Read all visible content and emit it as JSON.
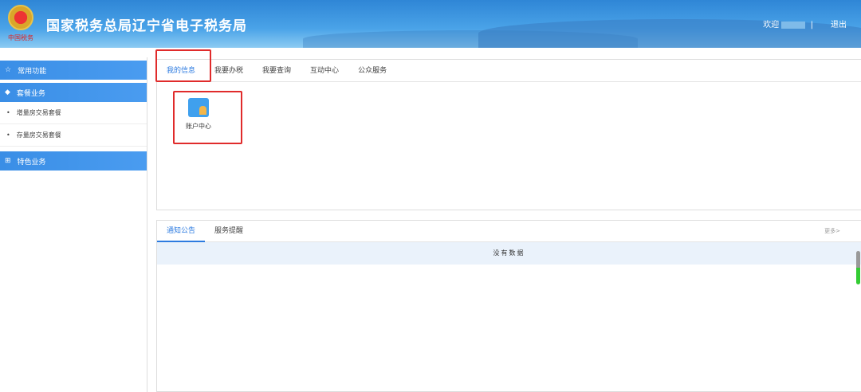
{
  "header": {
    "title": "国家税务总局辽宁省电子税务局",
    "seal": "中国税务",
    "welcome": "欢迎",
    "logout": "退出"
  },
  "sidebar": {
    "common": "常用功能",
    "package": "套餐业务",
    "package_items": [
      "增量房交易套餐",
      "存量房交易套餐"
    ],
    "special": "特色业务"
  },
  "top_tabs": [
    "我的信息",
    "我要办税",
    "我要查询",
    "互动中心",
    "公众服务"
  ],
  "account_center": "账户中心",
  "notice": {
    "tabs": [
      "通知公告",
      "服务提醒"
    ],
    "more": "更多>",
    "empty": "没有数据"
  },
  "colors": {
    "accent": "#2d7be0",
    "highlight": "#e02b2b"
  }
}
